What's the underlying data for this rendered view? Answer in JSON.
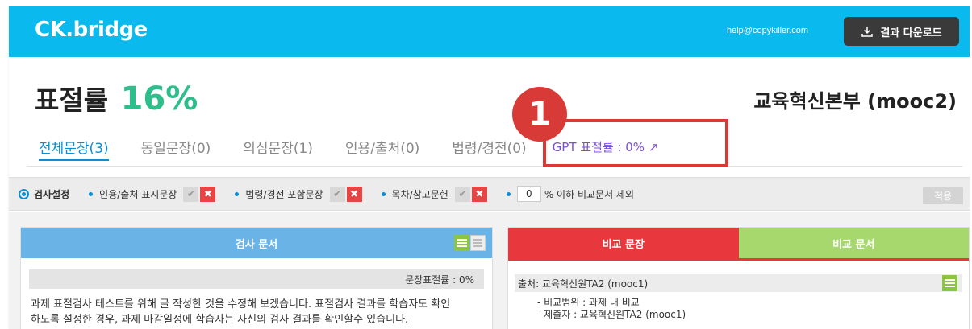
{
  "header": {
    "logo": "CK.bridge",
    "email": "help@copykiller.com",
    "download_label": "결과 다운로드"
  },
  "summary": {
    "rate_label": "표절률",
    "rate_value": "16%",
    "organization": "교육혁신본부 (mooc2)"
  },
  "tabs": [
    {
      "label": "전체문장(3)",
      "active": true
    },
    {
      "label": "동일문장(0)"
    },
    {
      "label": "의심문장(1)"
    },
    {
      "label": "인용/출처(0)"
    },
    {
      "label": "법령/경전(0)"
    },
    {
      "label": "GPT 표절률 : 0% ↗"
    }
  ],
  "callout": {
    "number": "1"
  },
  "settings": {
    "title": "검사설정",
    "options": [
      {
        "label": "인용/출처 표시문장"
      },
      {
        "label": "법령/경전 포함문장"
      },
      {
        "label": "목차/참고문헌"
      }
    ],
    "threshold_value": "0",
    "threshold_label": "% 이하 비교문서 제외",
    "apply_label": "적용"
  },
  "left_panel": {
    "title": "검사 문서",
    "sentence_rate": "문장표절률 : 0%",
    "text_lines": [
      "과제 표절검사 테스트를 위해 글 작성한 것을 수정해 보겠습니다. 표절검사 결과를 학습자도 확인",
      "하도록 설정한 경우, 과제 마감일정에 학습자는 자신의 검사 결과를 확인할수 있습니다."
    ]
  },
  "right_panel": {
    "tab_compare_sentence": "비교 문장",
    "tab_compare_doc": "비교 문서",
    "source": "출처: 교육혁신원TA2 (mooc1)",
    "meta": [
      "- 비교범위 : 과제 내 비교",
      "- 제출자 : 교육혁신원TA2 (mooc1)"
    ]
  },
  "colors": {
    "header_bg": "#0ab9ee",
    "accent_green": "#2dbe8c",
    "tab_active": "#0a8fd4",
    "gpt_purple": "#7b4fd6",
    "callout_red": "#d83a37"
  }
}
